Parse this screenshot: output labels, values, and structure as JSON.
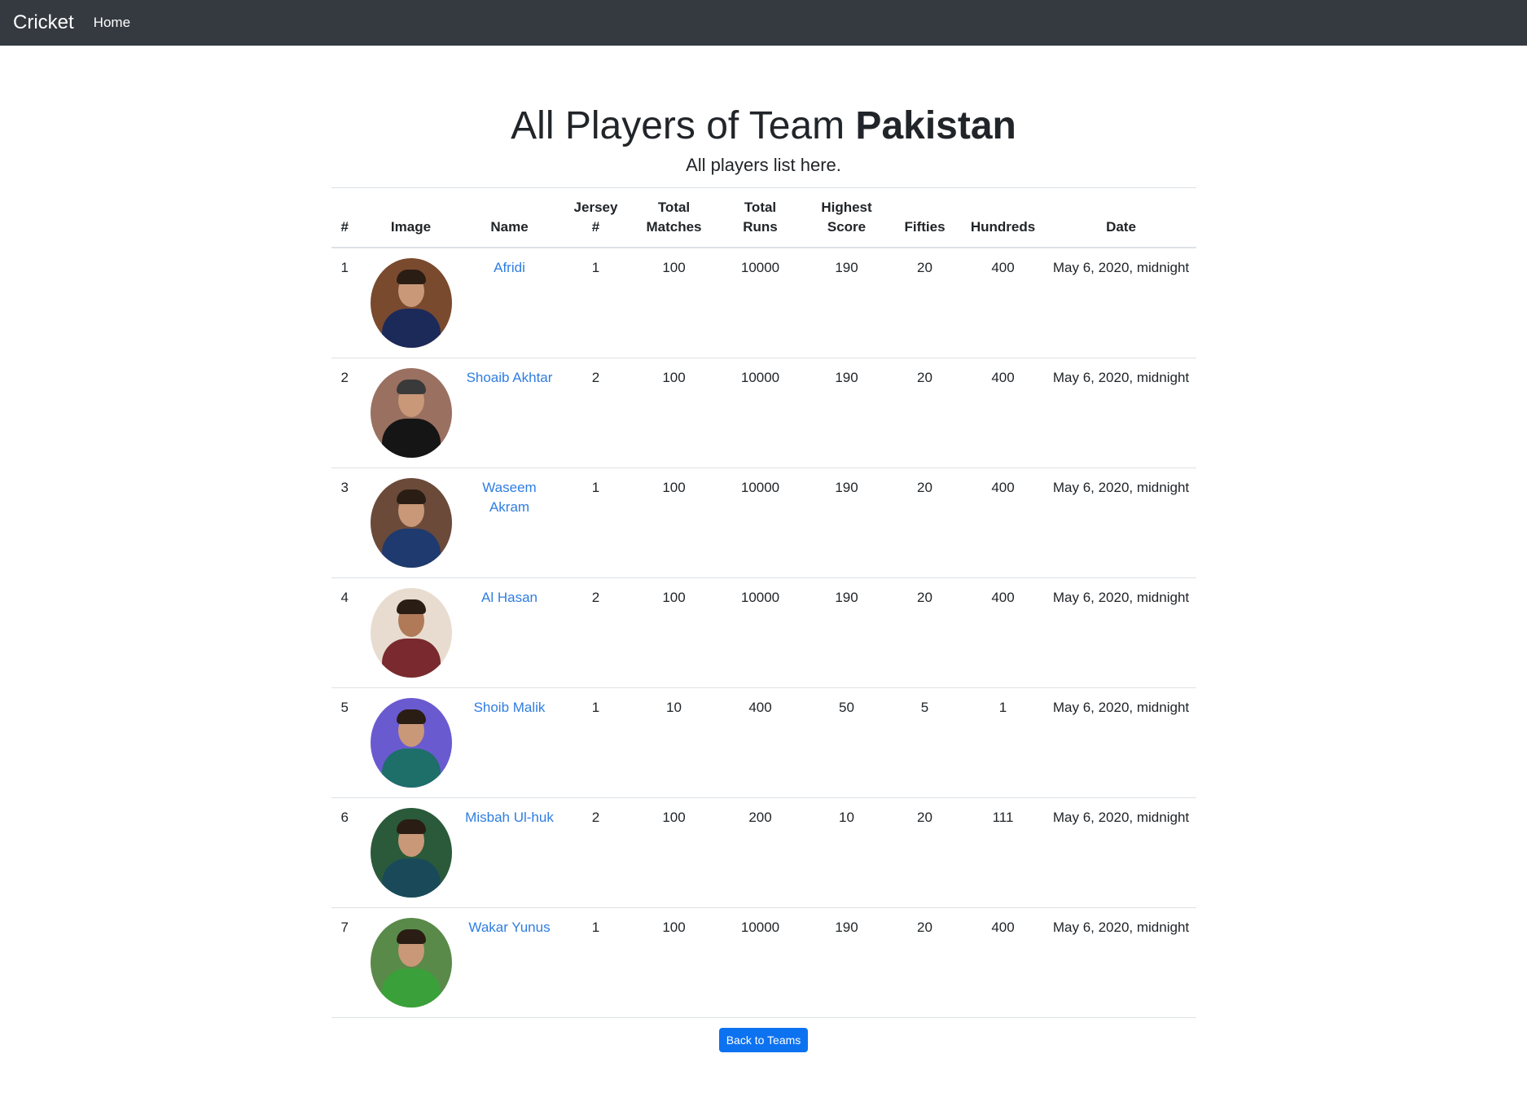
{
  "navbar": {
    "brand": "Cricket",
    "home": "Home"
  },
  "page": {
    "title_prefix": "All Players of Team ",
    "team": "Pakistan",
    "subtitle": "All players list here."
  },
  "table": {
    "headers": {
      "idx": "#",
      "image": "Image",
      "name": "Name",
      "jersey_1": "Jersey",
      "jersey_2": "#",
      "matches_1": "Total",
      "matches_2": "Matches",
      "runs_1": "Total",
      "runs_2": "Runs",
      "highest_1": "Highest",
      "highest_2": "Score",
      "fifties": "Fifties",
      "hundreds": "Hundreds",
      "date": "Date"
    },
    "rows": [
      {
        "idx": "1",
        "name": "Afridi",
        "jersey": "1",
        "matches": "100",
        "runs": "10000",
        "highest": "190",
        "fifties": "20",
        "hundreds": "400",
        "date": "May 6, 2020, midnight"
      },
      {
        "idx": "2",
        "name": "Shoaib Akhtar",
        "jersey": "2",
        "matches": "100",
        "runs": "10000",
        "highest": "190",
        "fifties": "20",
        "hundreds": "400",
        "date": "May 6, 2020, midnight"
      },
      {
        "idx": "3",
        "name": "Waseem Akram",
        "jersey": "1",
        "matches": "100",
        "runs": "10000",
        "highest": "190",
        "fifties": "20",
        "hundreds": "400",
        "date": "May 6, 2020, midnight"
      },
      {
        "idx": "4",
        "name": "Al Hasan",
        "jersey": "2",
        "matches": "100",
        "runs": "10000",
        "highest": "190",
        "fifties": "20",
        "hundreds": "400",
        "date": "May 6, 2020, midnight"
      },
      {
        "idx": "5",
        "name": "Shoib Malik",
        "jersey": "1",
        "matches": "10",
        "runs": "400",
        "highest": "50",
        "fifties": "5",
        "hundreds": "1",
        "date": "May 6, 2020, midnight"
      },
      {
        "idx": "6",
        "name": "Misbah Ul-huk",
        "jersey": "2",
        "matches": "100",
        "runs": "200",
        "highest": "10",
        "fifties": "20",
        "hundreds": "111",
        "date": "May 6, 2020, midnight"
      },
      {
        "idx": "7",
        "name": "Wakar Yunus",
        "jersey": "1",
        "matches": "100",
        "runs": "10000",
        "highest": "190",
        "fifties": "20",
        "hundreds": "400",
        "date": "May 6, 2020, midnight"
      }
    ]
  },
  "button": {
    "back": "Back to Teams"
  },
  "colors": {
    "navbar": "#343a40",
    "link": "#2f7de1",
    "button": "#0d72f0"
  }
}
